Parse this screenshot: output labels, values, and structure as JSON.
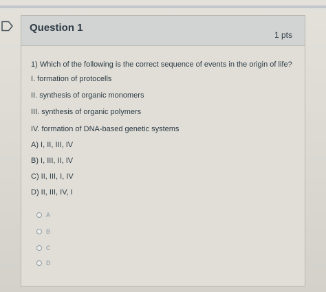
{
  "question": {
    "title": "Question 1",
    "points": "1 pts",
    "prompt": "1) Which of the following is the correct sequence of events in the origin of life?",
    "statements": [
      "I. formation of protocells",
      "II. synthesis of organic monomers",
      "III. synthesis of organic polymers",
      "IV. formation of DNA-based genetic systems"
    ],
    "choices": [
      "A) I, II, III, IV",
      "B) I, III, II, IV",
      "C) II, III, I, IV",
      "D) II, III, IV, I"
    ]
  },
  "answers": [
    {
      "label": "A"
    },
    {
      "label": "B"
    },
    {
      "label": "C"
    },
    {
      "label": "D"
    }
  ],
  "icons": {
    "flag": "flag-icon"
  },
  "colors": {
    "text": "#2d3b45",
    "header_bg": "#d2d3d3"
  }
}
